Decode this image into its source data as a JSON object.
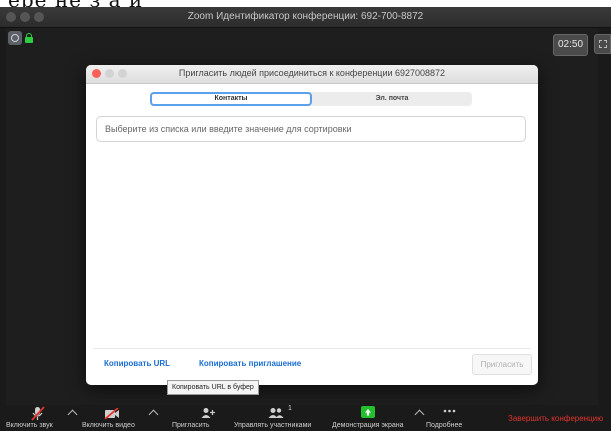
{
  "window": {
    "title": "Zoom Идентификатор конференции: 692-700-8872",
    "timer": "02:50"
  },
  "dialog": {
    "title": "Пригласить людей присоединиться к конференции 6927008872",
    "tabs": [
      {
        "label": "Контакты",
        "active": true
      },
      {
        "label": "Эл. почта",
        "active": false
      }
    ],
    "search_placeholder": "Выберите из списка или введите значение для сортировки",
    "copy_url_label": "Копировать URL",
    "copy_invitation_label": "Копировать приглашение",
    "invite_label": "Пригласить"
  },
  "tooltip": {
    "text": "Копировать URL в буфер"
  },
  "toolbar": {
    "items": [
      {
        "label": "Включить звук",
        "icon": "muted-microphone-icon"
      },
      {
        "label": "Включить видео",
        "icon": "video-off-icon"
      },
      {
        "label": "Пригласить",
        "icon": "add-person-icon"
      },
      {
        "label": "Управлять участниками",
        "icon": "participants-icon",
        "count": "1"
      },
      {
        "label": "Демонстрация экрана",
        "icon": "share-screen-icon"
      },
      {
        "label": "Подробнее",
        "icon": "more-icon"
      }
    ],
    "end_label": "Завершить конференцию"
  },
  "colors": {
    "accent": "#1a6dd2",
    "share_green": "#22c02c",
    "end_red": "#e0342c",
    "tab_focus": "#5ba0ea"
  }
}
